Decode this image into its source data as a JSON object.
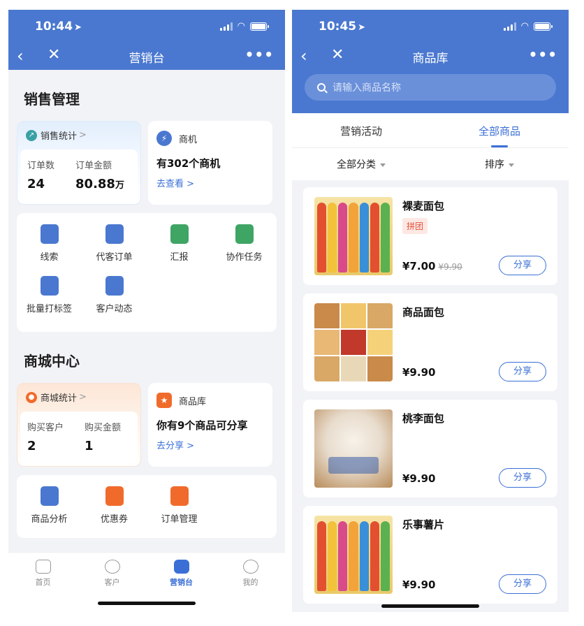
{
  "left": {
    "status": {
      "time": "10:44"
    },
    "nav": {
      "title": "营销台"
    },
    "sales": {
      "section_title": "销售管理",
      "stats_title": "销售统计",
      "stats_arrow": ">",
      "order_count_label": "订单数",
      "order_count": "24",
      "order_amount_label": "订单金额",
      "order_amount": "80.88",
      "order_amount_unit": "万",
      "opp_title": "商机",
      "opp_text": "有302个商机",
      "opp_link": "去查看 >",
      "grid": [
        {
          "label": "线索",
          "icon": "lead-icon",
          "color": "#4a78d0"
        },
        {
          "label": "代客订单",
          "icon": "proxy-order-icon",
          "color": "#4a78d0"
        },
        {
          "label": "汇报",
          "icon": "report-icon",
          "color": "#3fa564"
        },
        {
          "label": "协作任务",
          "icon": "task-icon",
          "color": "#3fa564"
        },
        {
          "label": "批量打标签",
          "icon": "tag-icon",
          "color": "#4a78d0"
        },
        {
          "label": "客户动态",
          "icon": "customer-activity-icon",
          "color": "#4a78d0"
        }
      ]
    },
    "mall": {
      "section_title": "商城中心",
      "stats_title": "商城统计",
      "stats_arrow": ">",
      "buyers_label": "购买客户",
      "buyers": "2",
      "amount_label": "购买金额",
      "amount": "1",
      "lib_title": "商品库",
      "lib_text": "你有9个商品可分享",
      "lib_link": "去分享 >",
      "grid": [
        {
          "label": "商品分析",
          "icon": "product-analysis-icon",
          "color": "#4a78d0"
        },
        {
          "label": "优惠券",
          "icon": "coupon-icon",
          "color": "#f06b2b"
        },
        {
          "label": "订单管理",
          "icon": "order-manage-icon",
          "color": "#f06b2b"
        }
      ]
    },
    "tabbar": [
      {
        "label": "首页",
        "icon": "home-icon"
      },
      {
        "label": "客户",
        "icon": "person-icon"
      },
      {
        "label": "营销台",
        "icon": "marketing-icon",
        "active": true
      },
      {
        "label": "我的",
        "icon": "smile-icon"
      }
    ]
  },
  "right": {
    "status": {
      "time": "10:45"
    },
    "nav": {
      "title": "商品库"
    },
    "search": {
      "placeholder": "请输入商品名称"
    },
    "tabs": [
      "营销活动",
      "全部商品"
    ],
    "filters": [
      "全部分类",
      "排序"
    ],
    "share_label": "分享",
    "products": [
      {
        "name": "裸麦面包",
        "tag": "拼团",
        "price": "¥7.00",
        "old_price": "¥9.90",
        "image": "chips"
      },
      {
        "name": "商品面包",
        "tag": "",
        "price": "¥9.90",
        "old_price": "",
        "image": "collage"
      },
      {
        "name": "桃李面包",
        "tag": "",
        "price": "¥9.90",
        "old_price": "",
        "image": "bag"
      },
      {
        "name": "乐事薯片",
        "tag": "",
        "price": "¥9.90",
        "old_price": "",
        "image": "chips"
      }
    ]
  }
}
